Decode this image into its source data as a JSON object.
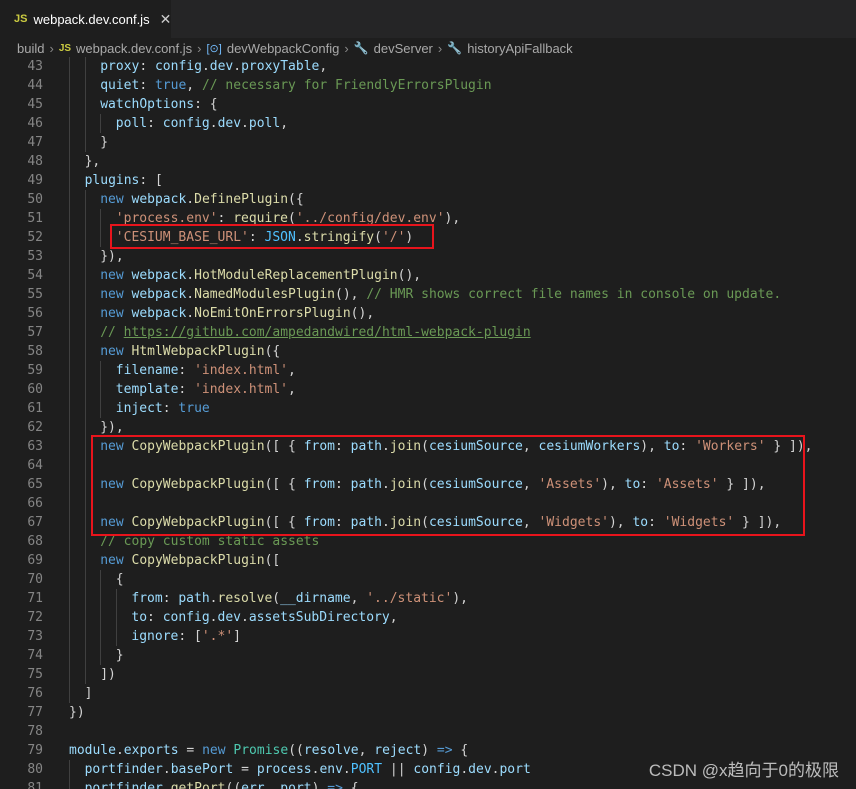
{
  "tab": {
    "badge": "JS",
    "title": "webpack.dev.conf.js",
    "close": "✕"
  },
  "breadcrumb": {
    "items": [
      {
        "text": "build",
        "icon": ""
      },
      {
        "text": "webpack.dev.conf.js",
        "icon": "JS"
      },
      {
        "text": "devWebpackConfig",
        "icon": "[⊙]"
      },
      {
        "text": "devServer",
        "icon": "🔧"
      },
      {
        "text": "historyApiFallback",
        "icon": "🔧"
      }
    ],
    "separator": "›"
  },
  "colors": {
    "keyword": "#569cd6",
    "property": "#9cdcfe",
    "string": "#ce9178",
    "function": "#dcdcaa",
    "class": "#4ec9b0",
    "comment": "#6a9955",
    "plain": "#d4d4d4",
    "constant": "#4fc1ff",
    "highlight": "#e8141c"
  },
  "lines": [
    {
      "n": "43",
      "indent": 2,
      "t": [
        [
          "p",
          "proxy"
        ],
        [
          "d",
          ": "
        ],
        [
          "p",
          "config"
        ],
        [
          "d",
          "."
        ],
        [
          "p",
          "dev"
        ],
        [
          "d",
          "."
        ],
        [
          "p",
          "proxyTable"
        ],
        [
          "d",
          ","
        ]
      ]
    },
    {
      "n": "44",
      "indent": 2,
      "t": [
        [
          "p",
          "quiet"
        ],
        [
          "d",
          ": "
        ],
        [
          "k",
          "true"
        ],
        [
          "d",
          ", "
        ],
        [
          "c",
          "// necessary for FriendlyErrorsPlugin"
        ]
      ]
    },
    {
      "n": "45",
      "indent": 2,
      "t": [
        [
          "p",
          "watchOptions"
        ],
        [
          "d",
          ": {"
        ]
      ]
    },
    {
      "n": "46",
      "indent": 3,
      "t": [
        [
          "p",
          "poll"
        ],
        [
          "d",
          ": "
        ],
        [
          "p",
          "config"
        ],
        [
          "d",
          "."
        ],
        [
          "p",
          "dev"
        ],
        [
          "d",
          "."
        ],
        [
          "p",
          "poll"
        ],
        [
          "d",
          ","
        ]
      ]
    },
    {
      "n": "47",
      "indent": 2,
      "t": [
        [
          "d",
          "}"
        ]
      ]
    },
    {
      "n": "48",
      "indent": 1,
      "t": [
        [
          "d",
          "},"
        ]
      ]
    },
    {
      "n": "49",
      "indent": 1,
      "t": [
        [
          "p",
          "plugins"
        ],
        [
          "d",
          ": ["
        ]
      ]
    },
    {
      "n": "50",
      "indent": 2,
      "t": [
        [
          "k",
          "new "
        ],
        [
          "p",
          "webpack"
        ],
        [
          "d",
          "."
        ],
        [
          "f",
          "DefinePlugin"
        ],
        [
          "d",
          "({"
        ]
      ]
    },
    {
      "n": "51",
      "indent": 3,
      "t": [
        [
          "s",
          "'process.env'"
        ],
        [
          "d",
          ": "
        ],
        [
          "f",
          "require"
        ],
        [
          "d",
          "("
        ],
        [
          "s",
          "'../config/dev.env'"
        ],
        [
          "d",
          "),"
        ]
      ]
    },
    {
      "n": "52",
      "indent": 3,
      "t": [
        [
          "s",
          "'CESIUM_BASE_URL'"
        ],
        [
          "d",
          ": "
        ],
        [
          "o",
          "JSON"
        ],
        [
          "d",
          "."
        ],
        [
          "f",
          "stringify"
        ],
        [
          "d",
          "("
        ],
        [
          "s",
          "'/'"
        ],
        [
          "d",
          ")"
        ]
      ]
    },
    {
      "n": "53",
      "indent": 2,
      "t": [
        [
          "d",
          "}),"
        ]
      ]
    },
    {
      "n": "54",
      "indent": 2,
      "t": [
        [
          "k",
          "new "
        ],
        [
          "p",
          "webpack"
        ],
        [
          "d",
          "."
        ],
        [
          "f",
          "HotModuleReplacementPlugin"
        ],
        [
          "d",
          "(),"
        ]
      ]
    },
    {
      "n": "55",
      "indent": 2,
      "t": [
        [
          "k",
          "new "
        ],
        [
          "p",
          "webpack"
        ],
        [
          "d",
          "."
        ],
        [
          "f",
          "NamedModulesPlugin"
        ],
        [
          "d",
          "(), "
        ],
        [
          "c",
          "// HMR shows correct file names in console on update."
        ]
      ]
    },
    {
      "n": "56",
      "indent": 2,
      "t": [
        [
          "k",
          "new "
        ],
        [
          "p",
          "webpack"
        ],
        [
          "d",
          "."
        ],
        [
          "f",
          "NoEmitOnErrorsPlugin"
        ],
        [
          "d",
          "(),"
        ]
      ]
    },
    {
      "n": "57",
      "indent": 2,
      "t": [
        [
          "c",
          "// "
        ],
        [
          "u",
          "https://github.com/ampedandwired/html-webpack-plugin"
        ]
      ]
    },
    {
      "n": "58",
      "indent": 2,
      "t": [
        [
          "k",
          "new "
        ],
        [
          "f",
          "HtmlWebpackPlugin"
        ],
        [
          "d",
          "({"
        ]
      ]
    },
    {
      "n": "59",
      "indent": 3,
      "t": [
        [
          "p",
          "filename"
        ],
        [
          "d",
          ": "
        ],
        [
          "s",
          "'index.html'"
        ],
        [
          "d",
          ","
        ]
      ]
    },
    {
      "n": "60",
      "indent": 3,
      "t": [
        [
          "p",
          "template"
        ],
        [
          "d",
          ": "
        ],
        [
          "s",
          "'index.html'"
        ],
        [
          "d",
          ","
        ]
      ]
    },
    {
      "n": "61",
      "indent": 3,
      "t": [
        [
          "p",
          "inject"
        ],
        [
          "d",
          ": "
        ],
        [
          "k",
          "true"
        ]
      ]
    },
    {
      "n": "62",
      "indent": 2,
      "t": [
        [
          "d",
          "}),"
        ]
      ]
    },
    {
      "n": "63",
      "indent": 2,
      "t": [
        [
          "k",
          "new "
        ],
        [
          "f",
          "CopyWebpackPlugin"
        ],
        [
          "d",
          "([ { "
        ],
        [
          "p",
          "from"
        ],
        [
          "d",
          ": "
        ],
        [
          "p",
          "path"
        ],
        [
          "d",
          "."
        ],
        [
          "f",
          "join"
        ],
        [
          "d",
          "("
        ],
        [
          "p",
          "cesiumSource"
        ],
        [
          "d",
          ", "
        ],
        [
          "p",
          "cesiumWorkers"
        ],
        [
          "d",
          "), "
        ],
        [
          "p",
          "to"
        ],
        [
          "d",
          ": "
        ],
        [
          "s",
          "'Workers'"
        ],
        [
          "d",
          " } ]),"
        ]
      ]
    },
    {
      "n": "64",
      "indent": 2,
      "t": []
    },
    {
      "n": "65",
      "indent": 2,
      "t": [
        [
          "k",
          "new "
        ],
        [
          "f",
          "CopyWebpackPlugin"
        ],
        [
          "d",
          "([ { "
        ],
        [
          "p",
          "from"
        ],
        [
          "d",
          ": "
        ],
        [
          "p",
          "path"
        ],
        [
          "d",
          "."
        ],
        [
          "f",
          "join"
        ],
        [
          "d",
          "("
        ],
        [
          "p",
          "cesiumSource"
        ],
        [
          "d",
          ", "
        ],
        [
          "s",
          "'Assets'"
        ],
        [
          "d",
          "), "
        ],
        [
          "p",
          "to"
        ],
        [
          "d",
          ": "
        ],
        [
          "s",
          "'Assets'"
        ],
        [
          "d",
          " } ]),"
        ]
      ]
    },
    {
      "n": "66",
      "indent": 2,
      "t": []
    },
    {
      "n": "67",
      "indent": 2,
      "t": [
        [
          "k",
          "new "
        ],
        [
          "f",
          "CopyWebpackPlugin"
        ],
        [
          "d",
          "([ { "
        ],
        [
          "p",
          "from"
        ],
        [
          "d",
          ": "
        ],
        [
          "p",
          "path"
        ],
        [
          "d",
          "."
        ],
        [
          "f",
          "join"
        ],
        [
          "d",
          "("
        ],
        [
          "p",
          "cesiumSource"
        ],
        [
          "d",
          ", "
        ],
        [
          "s",
          "'Widgets'"
        ],
        [
          "d",
          "), "
        ],
        [
          "p",
          "to"
        ],
        [
          "d",
          ": "
        ],
        [
          "s",
          "'Widgets'"
        ],
        [
          "d",
          " } ]),"
        ]
      ]
    },
    {
      "n": "68",
      "indent": 2,
      "t": [
        [
          "c",
          "// copy custom static assets"
        ]
      ]
    },
    {
      "n": "69",
      "indent": 2,
      "t": [
        [
          "k",
          "new "
        ],
        [
          "f",
          "CopyWebpackPlugin"
        ],
        [
          "d",
          "(["
        ]
      ]
    },
    {
      "n": "70",
      "indent": 3,
      "t": [
        [
          "d",
          "{"
        ]
      ]
    },
    {
      "n": "71",
      "indent": 4,
      "t": [
        [
          "p",
          "from"
        ],
        [
          "d",
          ": "
        ],
        [
          "p",
          "path"
        ],
        [
          "d",
          "."
        ],
        [
          "f",
          "resolve"
        ],
        [
          "d",
          "("
        ],
        [
          "p",
          "__dirname"
        ],
        [
          "d",
          ", "
        ],
        [
          "s",
          "'../static'"
        ],
        [
          "d",
          "),"
        ]
      ]
    },
    {
      "n": "72",
      "indent": 4,
      "t": [
        [
          "p",
          "to"
        ],
        [
          "d",
          ": "
        ],
        [
          "p",
          "config"
        ],
        [
          "d",
          "."
        ],
        [
          "p",
          "dev"
        ],
        [
          "d",
          "."
        ],
        [
          "p",
          "assetsSubDirectory"
        ],
        [
          "d",
          ","
        ]
      ]
    },
    {
      "n": "73",
      "indent": 4,
      "t": [
        [
          "p",
          "ignore"
        ],
        [
          "d",
          ": ["
        ],
        [
          "s",
          "'.*'"
        ],
        [
          "d",
          "]"
        ]
      ]
    },
    {
      "n": "74",
      "indent": 3,
      "t": [
        [
          "d",
          "}"
        ]
      ]
    },
    {
      "n": "75",
      "indent": 2,
      "t": [
        [
          "d",
          "])"
        ]
      ]
    },
    {
      "n": "76",
      "indent": 1,
      "t": [
        [
          "d",
          "]"
        ]
      ]
    },
    {
      "n": "77",
      "indent": 0,
      "t": [
        [
          "d",
          "})"
        ]
      ]
    },
    {
      "n": "78",
      "indent": 0,
      "t": []
    },
    {
      "n": "79",
      "indent": 0,
      "t": [
        [
          "p",
          "module"
        ],
        [
          "d",
          "."
        ],
        [
          "p",
          "exports"
        ],
        [
          "d",
          " = "
        ],
        [
          "k",
          "new "
        ],
        [
          "x",
          "Promise"
        ],
        [
          "d",
          "(("
        ],
        [
          "p",
          "resolve"
        ],
        [
          "d",
          ", "
        ],
        [
          "p",
          "reject"
        ],
        [
          "d",
          ") "
        ],
        [
          "k",
          "=>"
        ],
        [
          "d",
          " {"
        ]
      ]
    },
    {
      "n": "80",
      "indent": 1,
      "t": [
        [
          "p",
          "portfinder"
        ],
        [
          "d",
          "."
        ],
        [
          "p",
          "basePort"
        ],
        [
          "d",
          " = "
        ],
        [
          "p",
          "process"
        ],
        [
          "d",
          "."
        ],
        [
          "p",
          "env"
        ],
        [
          "d",
          "."
        ],
        [
          "o",
          "PORT"
        ],
        [
          "d",
          " || "
        ],
        [
          "p",
          "config"
        ],
        [
          "d",
          "."
        ],
        [
          "p",
          "dev"
        ],
        [
          "d",
          "."
        ],
        [
          "p",
          "port"
        ]
      ]
    },
    {
      "n": "81",
      "indent": 1,
      "t": [
        [
          "p",
          "portfinder"
        ],
        [
          "d",
          "."
        ],
        [
          "f",
          "getPort"
        ],
        [
          "d",
          "(("
        ],
        [
          "p",
          "err"
        ],
        [
          "d",
          ", "
        ],
        [
          "p",
          "port"
        ],
        [
          "d",
          ") "
        ],
        [
          "k",
          "=>"
        ],
        [
          "d",
          " {"
        ]
      ]
    }
  ],
  "watermark": "CSDN @x趋向于0的极限"
}
